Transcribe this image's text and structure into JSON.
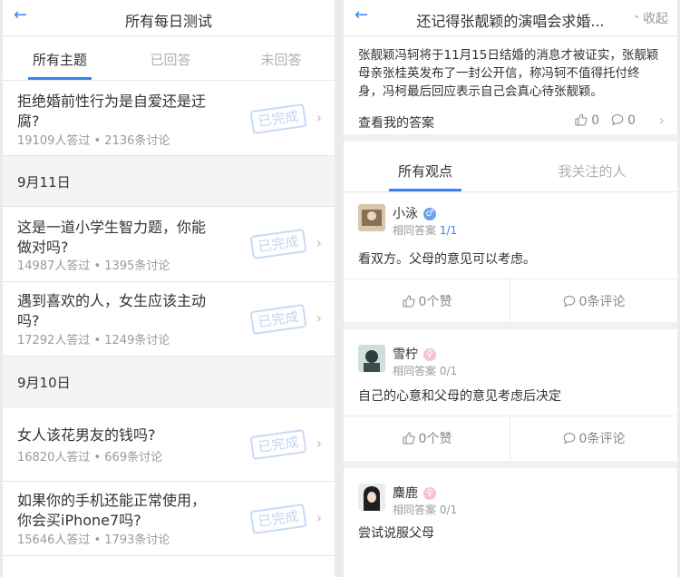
{
  "left": {
    "title": "所有每日测试",
    "tabs": [
      "所有主题",
      "已回答",
      "未回答"
    ],
    "stamp": "已完成",
    "items": [
      {
        "title": "拒绝婚前性行为是自爱还是迂腐?",
        "meta": "19109人答过 • 2136条讨论"
      },
      {
        "title": "这是一道小学生智力题，你能做对吗?",
        "meta": "14987人答过 • 1395条讨论"
      },
      {
        "title": "遇到喜欢的人，女生应该主动吗?",
        "meta": "17292人答过 • 1249条讨论"
      },
      {
        "title": "女人该花男友的钱吗?",
        "meta": "16820人答过 • 669条讨论"
      },
      {
        "title": "如果你的手机还能正常使用，你会买iPhone7吗?",
        "meta": "15646人答过 • 1793条讨论"
      }
    ],
    "dates": [
      "9月11日",
      "9月10日"
    ]
  },
  "right": {
    "title": "还记得张靓颖的演唱会求婚...",
    "collapse": "收起",
    "description": "张靓颖冯轲将于11月15日结婚的消息才被证实，张靓颖母亲张桂英发布了一封公开信，称冯轲不值得托付终身，冯柯最后回应表示自己会真心待张靓颖。",
    "my_answer": "查看我的答案",
    "likes": "0",
    "comments": "0",
    "tabs": [
      "所有观点",
      "我关注的人"
    ],
    "cards": [
      {
        "name": "小泳",
        "gender": "male",
        "same_label": "相同答案",
        "same_count": "1/1",
        "opinion": "看双方。父母的意见可以考虑。",
        "likes": "0个赞",
        "comments": "0条评论"
      },
      {
        "name": "雪柠",
        "gender": "female",
        "same_label": "相同答案",
        "same_count": "0/1",
        "opinion": "自己的心意和父母的意见考虑后决定",
        "likes": "0个赞",
        "comments": "0条评论"
      },
      {
        "name": "麋鹿",
        "gender": "female",
        "same_label": "相同答案",
        "same_count": "0/1",
        "opinion": "尝试说服父母"
      }
    ]
  },
  "colors": {
    "accent": "#3a84f0",
    "stamp": "#c2d6f0",
    "muted": "#9a9a9a"
  }
}
